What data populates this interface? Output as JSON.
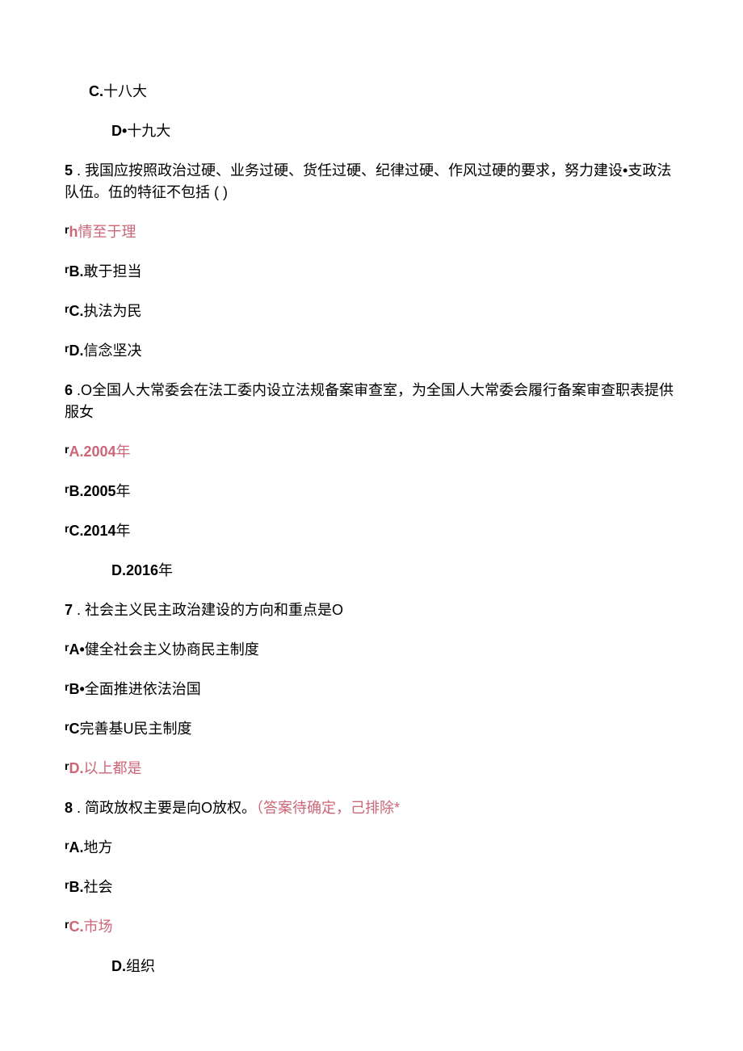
{
  "q4": {
    "optC": {
      "label": "C.",
      "text": "十八大"
    },
    "optD": {
      "label": "D•",
      "text": "十九大"
    }
  },
  "q5": {
    "num": "5",
    "text": " . 我国应按照政治过硬、业务过硬、货任过硬、纪律过硬、作风过硬的要求，努力建设•支政法队伍。伍的特征不包括 ( )",
    "optA": {
      "pre": "r",
      "label": "h",
      "text": "情至于理"
    },
    "optB": {
      "pre": "r",
      "label": "B.",
      "text": "敢于担当"
    },
    "optC": {
      "pre": "r",
      "label": "C.",
      "text": "执法为民"
    },
    "optD": {
      "pre": "r",
      "label": "D.",
      "text": "信念坚决"
    }
  },
  "q6": {
    "num": "6",
    "text": " .O全国人大常委会在法工委内设立法规备案审查室，为全国人大常委会履行备案审查职表提供服女",
    "optA": {
      "pre": "r",
      "label": "A.2004",
      "text": "年"
    },
    "optB": {
      "pre": "r",
      "label": "B.2005",
      "text": "年"
    },
    "optC": {
      "pre": "r",
      "label": "C.2014",
      "text": "年"
    },
    "optD": {
      "label": "D.2016",
      "text": "年"
    }
  },
  "q7": {
    "num": "7",
    "text": " . 社会主义民主政治建设的方向和重点是O",
    "optA": {
      "pre": "r",
      "label": "A•",
      "text": "健全社会主义协商民主制度"
    },
    "optB": {
      "pre": "r",
      "label": "B•",
      "text": "全面推进依法治国"
    },
    "optC": {
      "pre": "r",
      "label": "C",
      "text": "完善基U民主制度"
    },
    "optD": {
      "pre": "r",
      "label": "D.",
      "text": "以上都是"
    }
  },
  "q8": {
    "num": "8",
    "text": " . 简政放权主要是向O放权。",
    "note": "（答案待确定，己排除*",
    "optA": {
      "pre": "r",
      "label": "A.",
      "text": "地方"
    },
    "optB": {
      "pre": "r",
      "label": "B.",
      "text": "社会"
    },
    "optC": {
      "pre": "r",
      "label": "C.",
      "text": "市场"
    },
    "optD": {
      "label": "D.",
      "text": "组织"
    }
  }
}
